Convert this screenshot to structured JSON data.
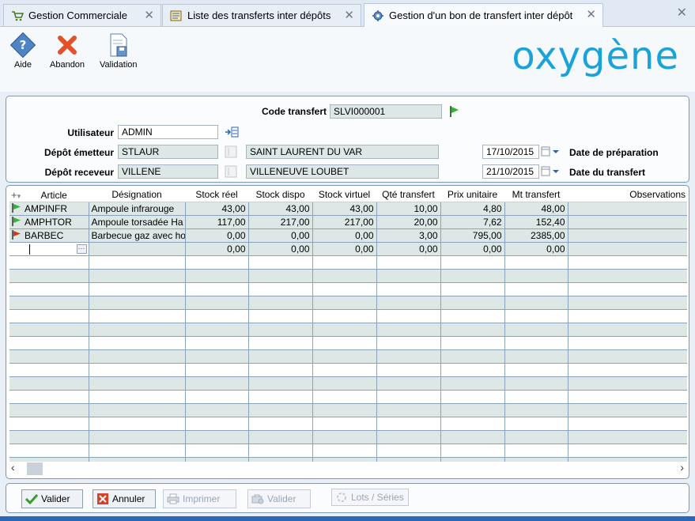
{
  "tabs": [
    {
      "label": "Gestion Commerciale",
      "icon": "cart-icon"
    },
    {
      "label": "Liste des transferts inter dépôts",
      "icon": "list-icon"
    },
    {
      "label": "Gestion d'un bon de transfert inter dépôt",
      "icon": "gear-icon"
    }
  ],
  "toolbar": {
    "aide": "Aide",
    "abandon": "Abandon",
    "validation": "Validation",
    "logo_text": "oxygène"
  },
  "form": {
    "code_transfert_label": "Code transfert",
    "code_transfert_value": "SLVI000001",
    "utilisateur_label": "Utilisateur",
    "utilisateur_value": "ADMIN",
    "depot_emetteur_label": "Dépôt émetteur",
    "depot_emetteur_code": "STLAUR",
    "depot_emetteur_name": "SAINT LAURENT DU VAR",
    "depot_receveur_label": "Dépôt receveur",
    "depot_receveur_code": "VILLENE",
    "depot_receveur_name": "VILLENEUVE LOUBET",
    "date_preparation_value": "17/10/2015",
    "date_preparation_label": "Date de préparation",
    "date_transfert_value": "21/10/2015",
    "date_transfert_label": "Date du transfert"
  },
  "grid": {
    "columns": [
      "Article",
      "Désignation",
      "Stock réel",
      "Stock dispo",
      "Stock virtuel",
      "Qté transfert",
      "Prix unitaire",
      "Mt transfert",
      "Observations"
    ],
    "rows": [
      {
        "flag": "green",
        "article": "AMPINFR",
        "designation": "Ampoule infrarouge",
        "stock_reel": "43,00",
        "stock_dispo": "43,00",
        "stock_virtuel": "43,00",
        "qte": "10,00",
        "prix": "4,80",
        "mt": "48,00",
        "obs": ""
      },
      {
        "flag": "green",
        "article": "AMPHTOR",
        "designation": "Ampoule torsadée Ha",
        "stock_reel": "117,00",
        "stock_dispo": "217,00",
        "stock_virtuel": "217,00",
        "qte": "20,00",
        "prix": "7,62",
        "mt": "152,40",
        "obs": ""
      },
      {
        "flag": "red",
        "article": "BARBEC",
        "designation": "Barbecue gaz avec ho",
        "stock_reel": "0,00",
        "stock_dispo": "0,00",
        "stock_virtuel": "0,00",
        "qte": "3,00",
        "prix": "795,00",
        "mt": "2385,00",
        "obs": ""
      },
      {
        "flag": "",
        "article": "",
        "designation": "",
        "stock_reel": "0,00",
        "stock_dispo": "0,00",
        "stock_virtuel": "0,00",
        "qte": "0,00",
        "prix": "0,00",
        "mt": "0,00",
        "obs": ""
      }
    ]
  },
  "buttons": {
    "valider": "Valider",
    "annuler": "Annuler",
    "imprimer": "Imprimer",
    "valider2": "Valider",
    "lots_series": "Lots / Séries"
  },
  "colors": {
    "flag_green": "#2fb52f",
    "flag_red": "#d63a1e",
    "logo": "#1aa3d8"
  }
}
